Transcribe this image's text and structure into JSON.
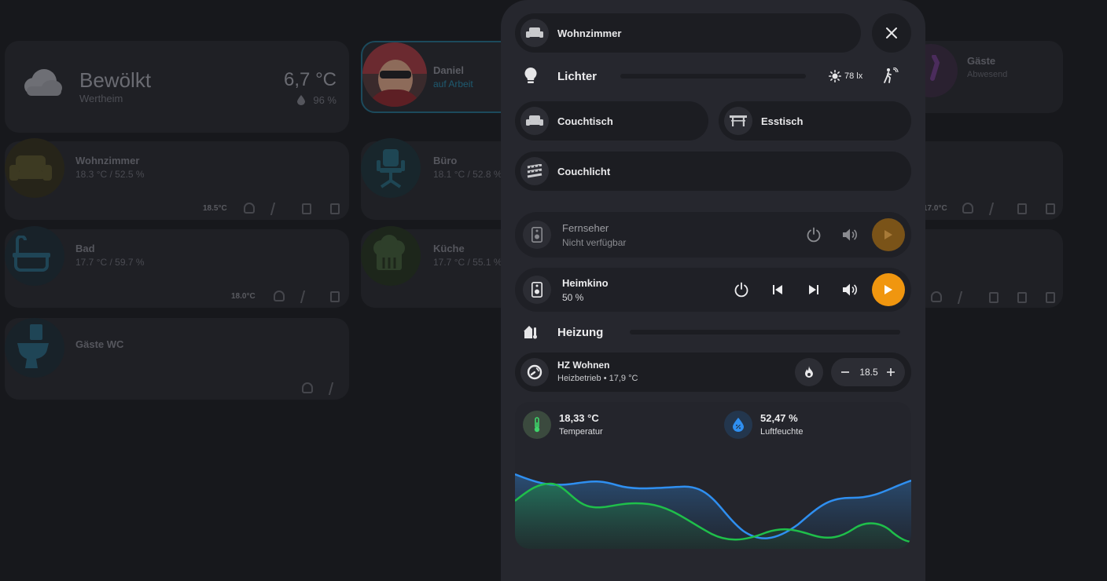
{
  "weather": {
    "condition": "Bewölkt",
    "location": "Wertheim",
    "temperature": "6,7 °C",
    "humidity": "96 %"
  },
  "person": {
    "name": "Daniel",
    "status": "auf Arbeit"
  },
  "guests": {
    "title": "Gäste",
    "status": "Abwesend"
  },
  "rooms": [
    {
      "name": "Wohnzimmer",
      "info": "18.3 °C / 52.5 %",
      "setpoint": "18.5°C"
    },
    {
      "name": "Büro",
      "info": "18.1 °C / 52.8 %"
    },
    {
      "name": "Bad",
      "info": "17.7 °C / 59.7 %",
      "setpoint": "18.0°C"
    },
    {
      "name": "Küche",
      "info": "17.7 °C / 55.1 %"
    },
    {
      "name": "Gäste WC"
    }
  ],
  "right_col": {
    "setpoint": "17.0°C"
  },
  "popup": {
    "room": "Wohnzimmer",
    "lights": {
      "title": "Lichter",
      "lux": "78 lx",
      "items": [
        "Couchtisch",
        "Esstisch",
        "Couchlicht"
      ]
    },
    "media": [
      {
        "name": "Fernseher",
        "status": "Nicht verfügbar"
      },
      {
        "name": "Heimkino",
        "status": "50 %"
      }
    ],
    "heating": {
      "title": "Heizung",
      "thermostat": "HZ Wohnen",
      "status": "Heizbetrieb • 17,9 °C",
      "setpoint": "18.5"
    },
    "sensors": {
      "temperature_value": "18,33 °C",
      "temperature_label": "Temperatur",
      "humidity_value": "52,47 %",
      "humidity_label": "Luftfeuchte"
    }
  },
  "colors": {
    "accent": "#f0960f",
    "temp_line": "#1fbf4a",
    "humidity_line": "#2f8ff0"
  }
}
